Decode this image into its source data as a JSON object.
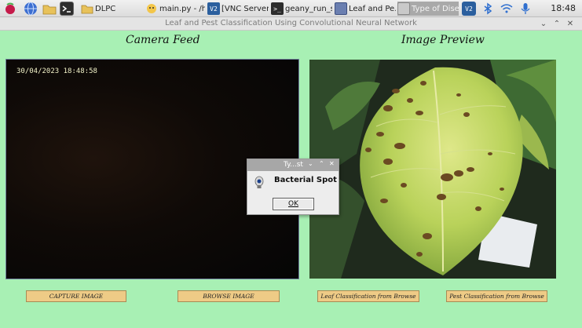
{
  "taskbar": {
    "items": [
      {
        "label": "DLPC",
        "icon": "folder-icon"
      },
      {
        "label": "main.py - /h...",
        "icon": "geany-icon"
      },
      {
        "label": "[VNC Server]",
        "icon": "vnc-icon"
      },
      {
        "label": "geany_run_s...",
        "icon": "terminal-icon"
      },
      {
        "label": "Leaf and Pe...",
        "icon": "window-icon"
      },
      {
        "label": "Type of Diseas...",
        "icon": "window-icon"
      }
    ],
    "clock": "18:48"
  },
  "window": {
    "title": "Leaf and Pest Classification Using Convolutional Neural Network"
  },
  "main": {
    "camera_heading": "Camera Feed",
    "preview_heading": "Image Preview",
    "timestamp": "30/04/2023 18:48:58"
  },
  "buttons": {
    "capture": "CAPTURE IMAGE",
    "browse": "BROWSE IMAGE",
    "leaf": "Leaf Classification from Browse",
    "pest": "Pest Classification from Browse"
  },
  "dialog": {
    "title": "Ty...st",
    "message": "Bacterial Spot",
    "ok_label": "OK",
    "icon": "lightbulb-icon"
  },
  "colors": {
    "background": "#a8f0b4",
    "button": "#eecb86",
    "active_task": "#a9a9a9"
  }
}
